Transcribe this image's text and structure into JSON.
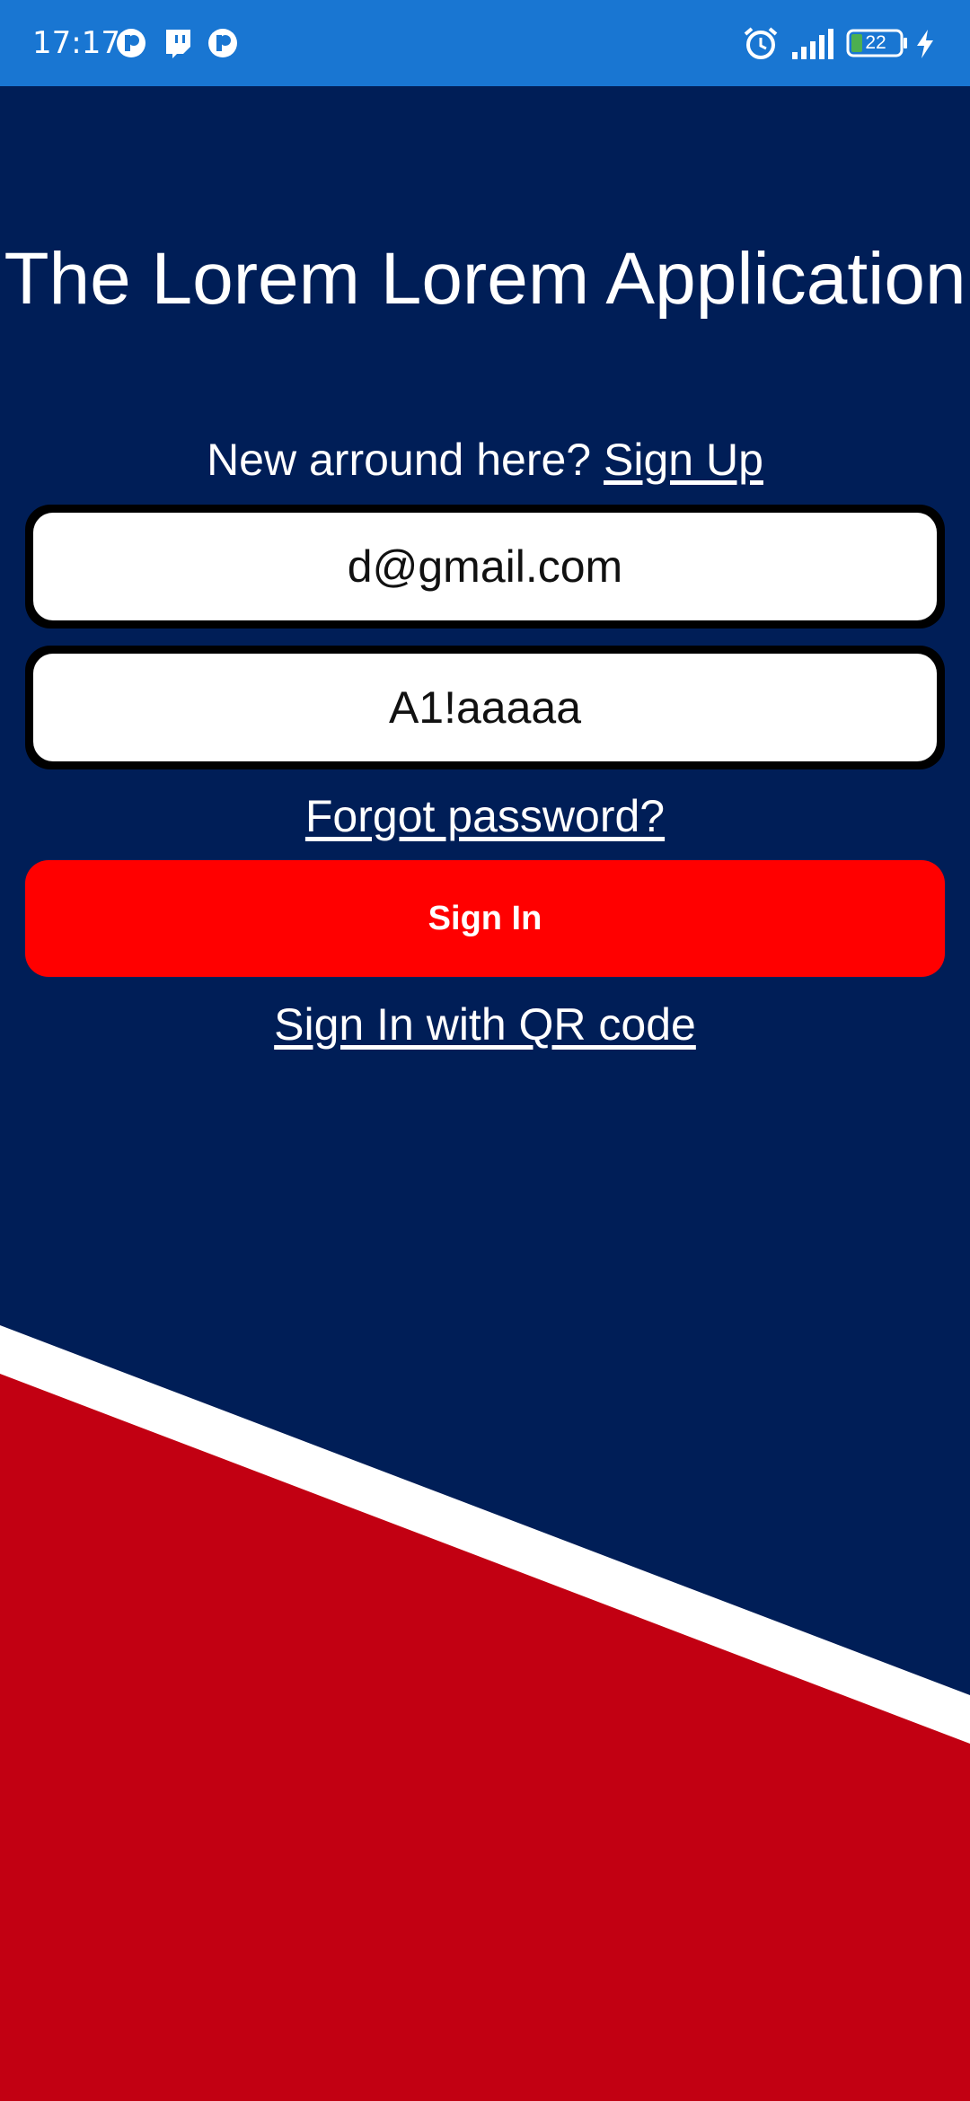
{
  "status_bar": {
    "time": "17:17",
    "battery_level": "22",
    "icons": [
      "notification-app-icon",
      "twitch-icon",
      "notification-app-icon",
      "alarm-icon",
      "signal-icon",
      "battery-icon",
      "charging-icon"
    ],
    "background": "#1976d2"
  },
  "login": {
    "title": "The Lorem Lorem Application",
    "signup_prompt": "New arround here?",
    "signup_link": "Sign Up",
    "email_value": "d@gmail.com",
    "password_value": "A1!aaaaa",
    "forgot_password": "Forgot password?",
    "signin_button": "Sign In",
    "qr_signin": "Sign In with QR code"
  },
  "colors": {
    "background": "#001e57",
    "accent_red": "#ff0000",
    "decor_red": "#c20012",
    "decor_white": "#ffffff"
  }
}
